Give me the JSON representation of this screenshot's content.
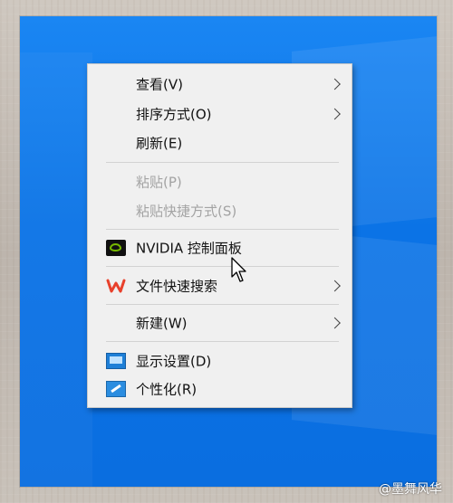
{
  "menu": {
    "items": [
      {
        "label": "查看(V)",
        "submenu": true
      },
      {
        "label": "排序方式(O)",
        "submenu": true
      },
      {
        "label": "刷新(E)"
      },
      {
        "label": "粘贴(P)",
        "disabled": true
      },
      {
        "label": "粘贴快捷方式(S)",
        "disabled": true
      },
      {
        "label": "NVIDIA 控制面板",
        "icon": "nvidia-icon"
      },
      {
        "label": "文件快速搜索",
        "icon": "wps-icon",
        "submenu": true
      },
      {
        "label": "新建(W)",
        "submenu": true
      },
      {
        "label": "显示设置(D)",
        "icon": "display-settings-icon"
      },
      {
        "label": "个性化(R)",
        "icon": "personalize-icon"
      }
    ]
  },
  "watermark": "@墨舞风华",
  "colors": {
    "desktop": "#0b73e6",
    "menu_bg": "#f0f0f0",
    "disabled_text": "#a3a3a3",
    "nvidia_green": "#76b900",
    "wps_red": "#e8412c"
  }
}
